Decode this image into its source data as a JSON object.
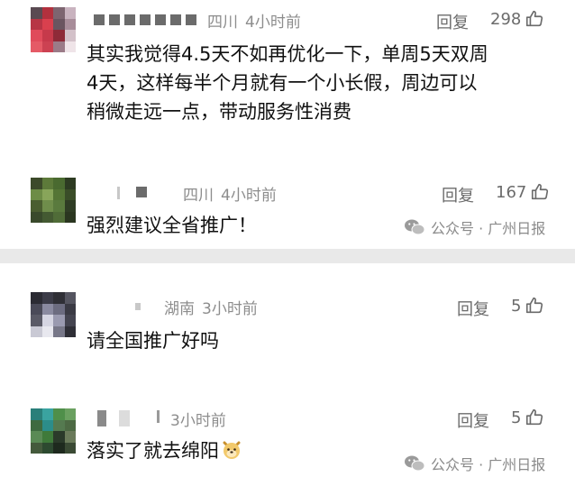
{
  "comments": [
    {
      "region": "四川",
      "time": "4小时前",
      "reply_label": "回复",
      "like_count": "298",
      "text_lines": [
        "其实我觉得4.5天不如再优化一下，单周5天双周",
        "4天，这样每半个月就有一个小长假，周边可以",
        "稍微走远一点，带动服务性消费"
      ]
    },
    {
      "region": "四川",
      "time": "4小时前",
      "reply_label": "回复",
      "like_count": "167",
      "text_lines": [
        "强烈建议全省推广！"
      ]
    },
    {
      "region": "湖南",
      "time": "3小时前",
      "reply_label": "回复",
      "like_count": "5",
      "text_lines": [
        "请全国推广好吗"
      ]
    },
    {
      "region": "",
      "time": "3小时前",
      "reply_label": "回复",
      "like_count": "5",
      "text_lines": [
        "落实了就去绵阳"
      ]
    }
  ],
  "watermarks": [
    {
      "text": "公众号 · 广州日报"
    },
    {
      "text": "公众号 · 广州日报"
    }
  ],
  "icons": {
    "like": "thumbs-up-icon",
    "wechat": "wechat-icon",
    "emoji": "dog-face-emoji"
  },
  "colors": {
    "background": "#e9e9e9",
    "card": "#ffffff",
    "meta": "#8d8d8d",
    "text": "#111111"
  }
}
